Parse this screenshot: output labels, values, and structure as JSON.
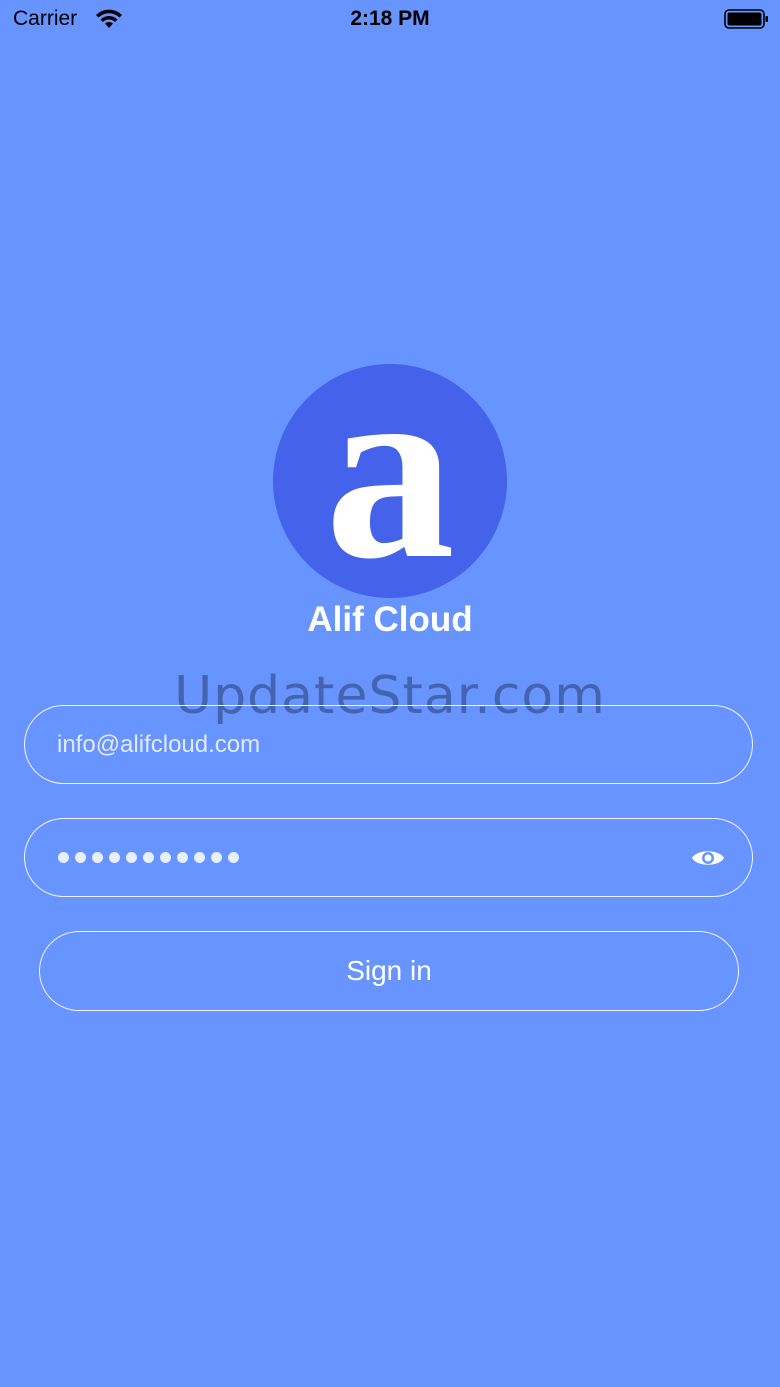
{
  "status_bar": {
    "carrier": "Carrier",
    "time": "2:18 PM",
    "icons": [
      "wifi-icon",
      "battery-icon"
    ]
  },
  "app": {
    "logo_letter": "a",
    "name": "Alif Cloud",
    "logo_color": "#4562EA"
  },
  "watermark": "UpdateStar.com",
  "login": {
    "email_placeholder": "info@alifcloud.com",
    "password_dots": 11,
    "password_toggle_icon": "eye-icon",
    "signin_label": "Sign in"
  },
  "colors": {
    "background": "#6894FF",
    "text": "#FFFFFF"
  }
}
